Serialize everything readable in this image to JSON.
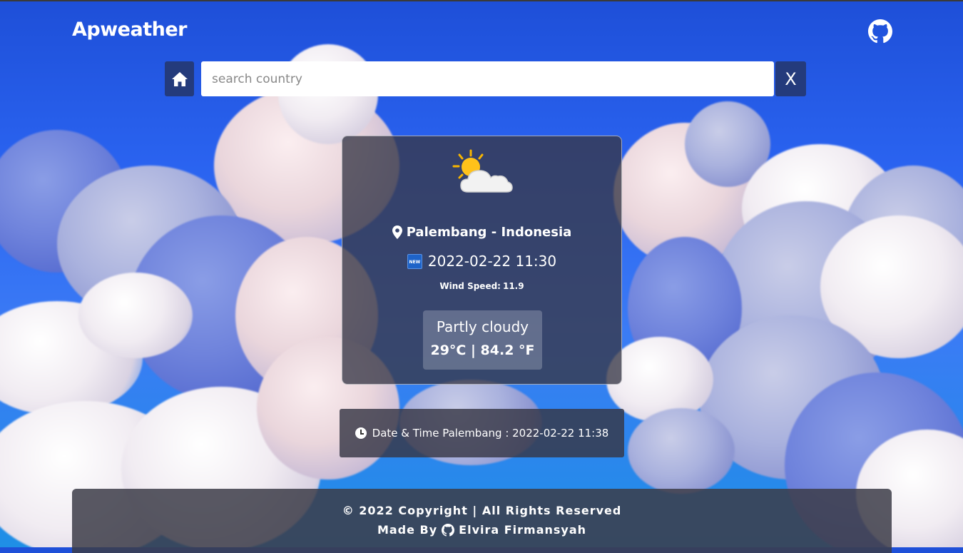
{
  "header": {
    "brand": "Apweather",
    "github_icon": "github-icon"
  },
  "search": {
    "home_icon": "home-icon",
    "placeholder": "search country",
    "value": "",
    "clear_label": "X"
  },
  "weather": {
    "icon": "partly-cloudy-icon",
    "location_icon": "map-pin-icon",
    "location": "Palembang - Indonesia",
    "badge_icon": "new-badge-icon",
    "badge_text": "NEW",
    "local_time": "2022-02-22 11:30",
    "wind_label": "Wind Speed:",
    "wind_value": "11.9",
    "condition": "Partly cloudy",
    "temperature": "29°C | 84.2 °F"
  },
  "datetime": {
    "icon": "clock-icon",
    "text": "Date & Time Palembang : 2022-02-22 11:38"
  },
  "footer": {
    "copyright": "© 2022 Copyright | All Rights Reserved",
    "made_by_label": "Made By",
    "author_icon": "github-icon",
    "author": "Elvira Firmansyah"
  },
  "colors": {
    "button_bg": "#243b7c",
    "card_bg": "#373746",
    "sky_blue": "#2a63f0"
  }
}
